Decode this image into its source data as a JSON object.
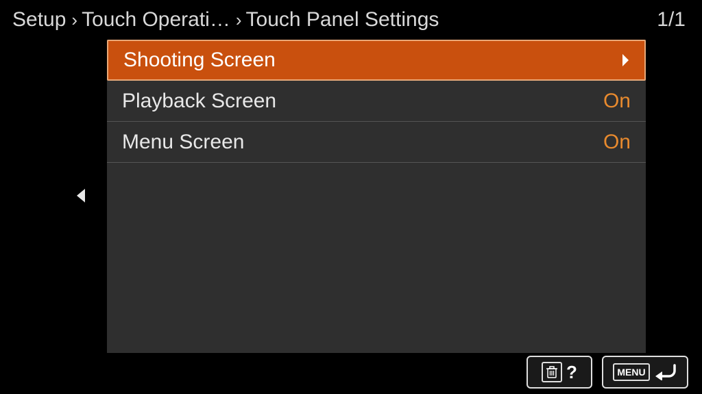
{
  "breadcrumb": {
    "level1": "Setup",
    "level2": "Touch Operati…",
    "level3": "Touch Panel Settings"
  },
  "page_indicator": "1/1",
  "menu": {
    "items": [
      {
        "label": "Shooting Screen",
        "value": "",
        "has_submenu": true,
        "selected": true
      },
      {
        "label": "Playback Screen",
        "value": "On",
        "has_submenu": false,
        "selected": false
      },
      {
        "label": "Menu Screen",
        "value": "On",
        "has_submenu": false,
        "selected": false
      }
    ]
  },
  "bottom": {
    "help_symbol": "?",
    "menu_label": "MENU"
  }
}
